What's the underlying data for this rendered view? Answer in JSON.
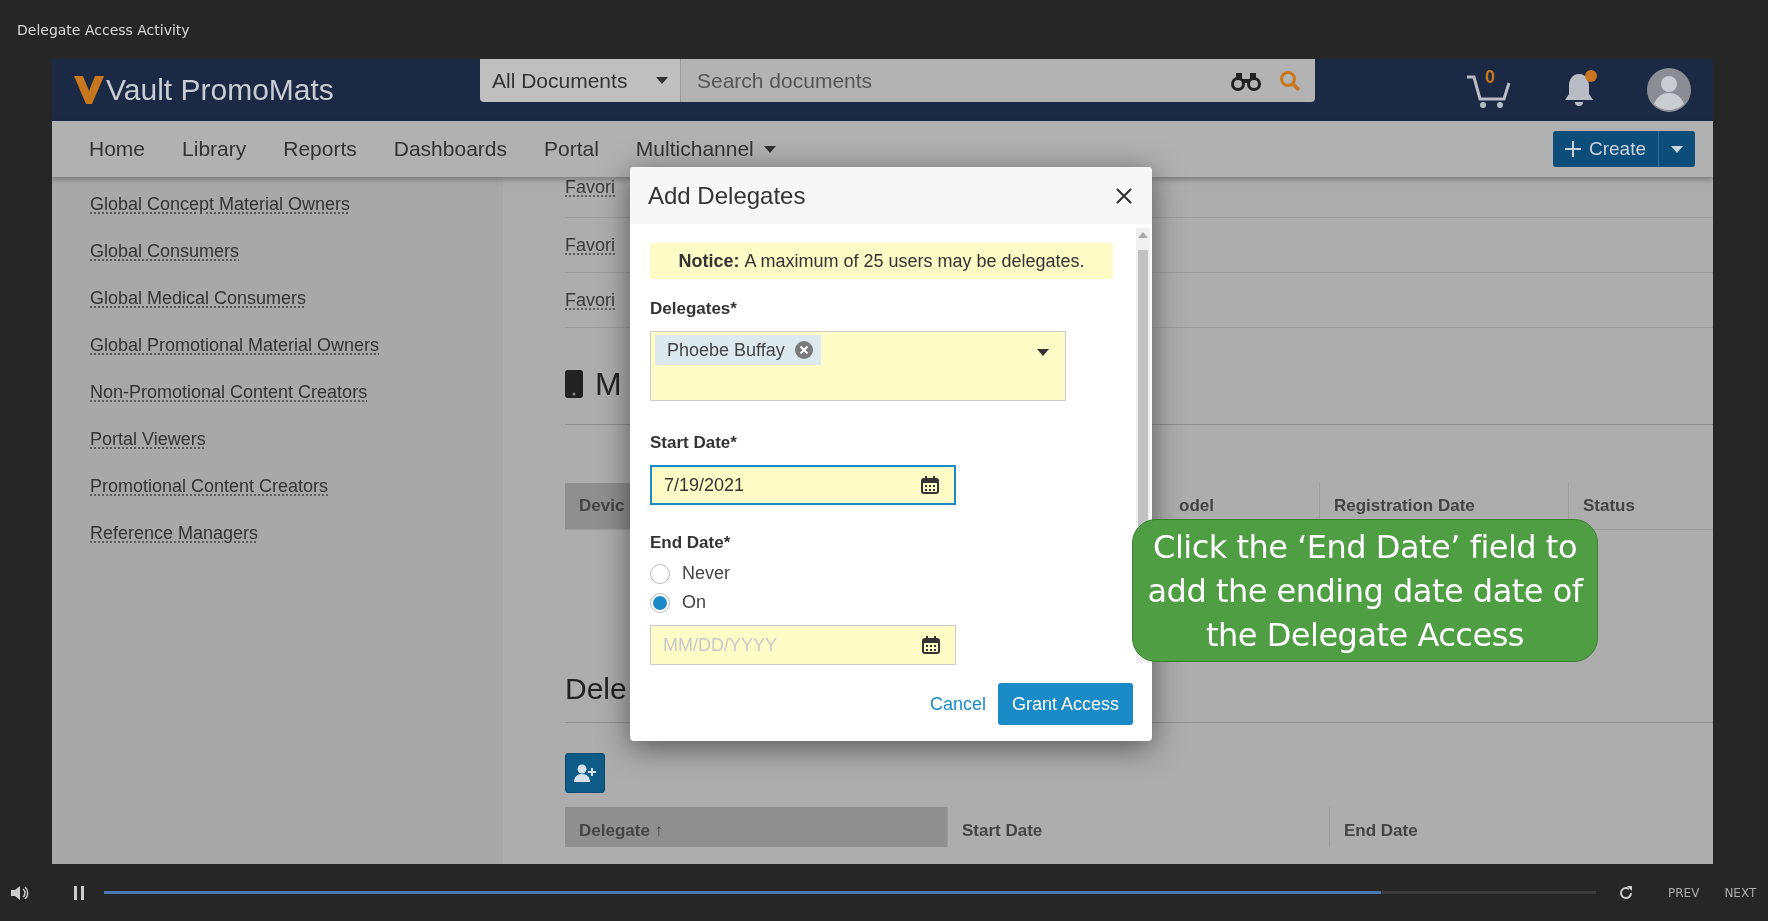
{
  "player_title": "Delegate Access Activity",
  "header": {
    "brand": "Vault PromoMats",
    "scope": "All Documents",
    "search": {
      "placeholder": "Search documents"
    },
    "cart_count": "0",
    "has_notification": true
  },
  "nav": {
    "items": [
      "Home",
      "Library",
      "Reports",
      "Dashboards",
      "Portal",
      "Multichannel"
    ],
    "create": "Create"
  },
  "sidebar": {
    "items": [
      "Global Concept Material Owners",
      "Global Consumers",
      "Global Medical Consumers",
      "Global Promotional Material Owners",
      "Non-Promotional Content Creators",
      "Portal Viewers",
      "Promotional Content Creators",
      "Reference Managers"
    ]
  },
  "content": {
    "favorite_rows": [
      "Favori",
      "Favori",
      "Favori"
    ],
    "section_heading": "M",
    "device_table": {
      "columns": [
        "Devic",
        "odel",
        "Registration Date",
        "Status"
      ]
    },
    "delegates_heading": "Dele",
    "delegates_table": {
      "columns": [
        "Delegate ↑",
        "Start Date",
        "End Date"
      ]
    }
  },
  "dialog": {
    "title": "Add Delegates",
    "notice_label": "Notice:",
    "notice": "A maximum of 25 users may be delegates.",
    "delegates": {
      "label": "Delegates*",
      "chips": [
        "Phoebe Buffay"
      ]
    },
    "start_date": {
      "label": "Start Date*",
      "value": "7/19/2021"
    },
    "end_date": {
      "label": "End Date*",
      "options": [
        {
          "label": "Never",
          "selected": false
        },
        {
          "label": "On",
          "selected": true
        }
      ],
      "placeholder": "MM/DD/YYYY"
    },
    "buttons": {
      "cancel": "Cancel",
      "confirm": "Grant Access"
    }
  },
  "callout": "Click the ‘End Date’ field to add the ending date date of the Delegate Access",
  "player": {
    "level": 0.856,
    "prev": "PREV",
    "next": "NEXT"
  }
}
